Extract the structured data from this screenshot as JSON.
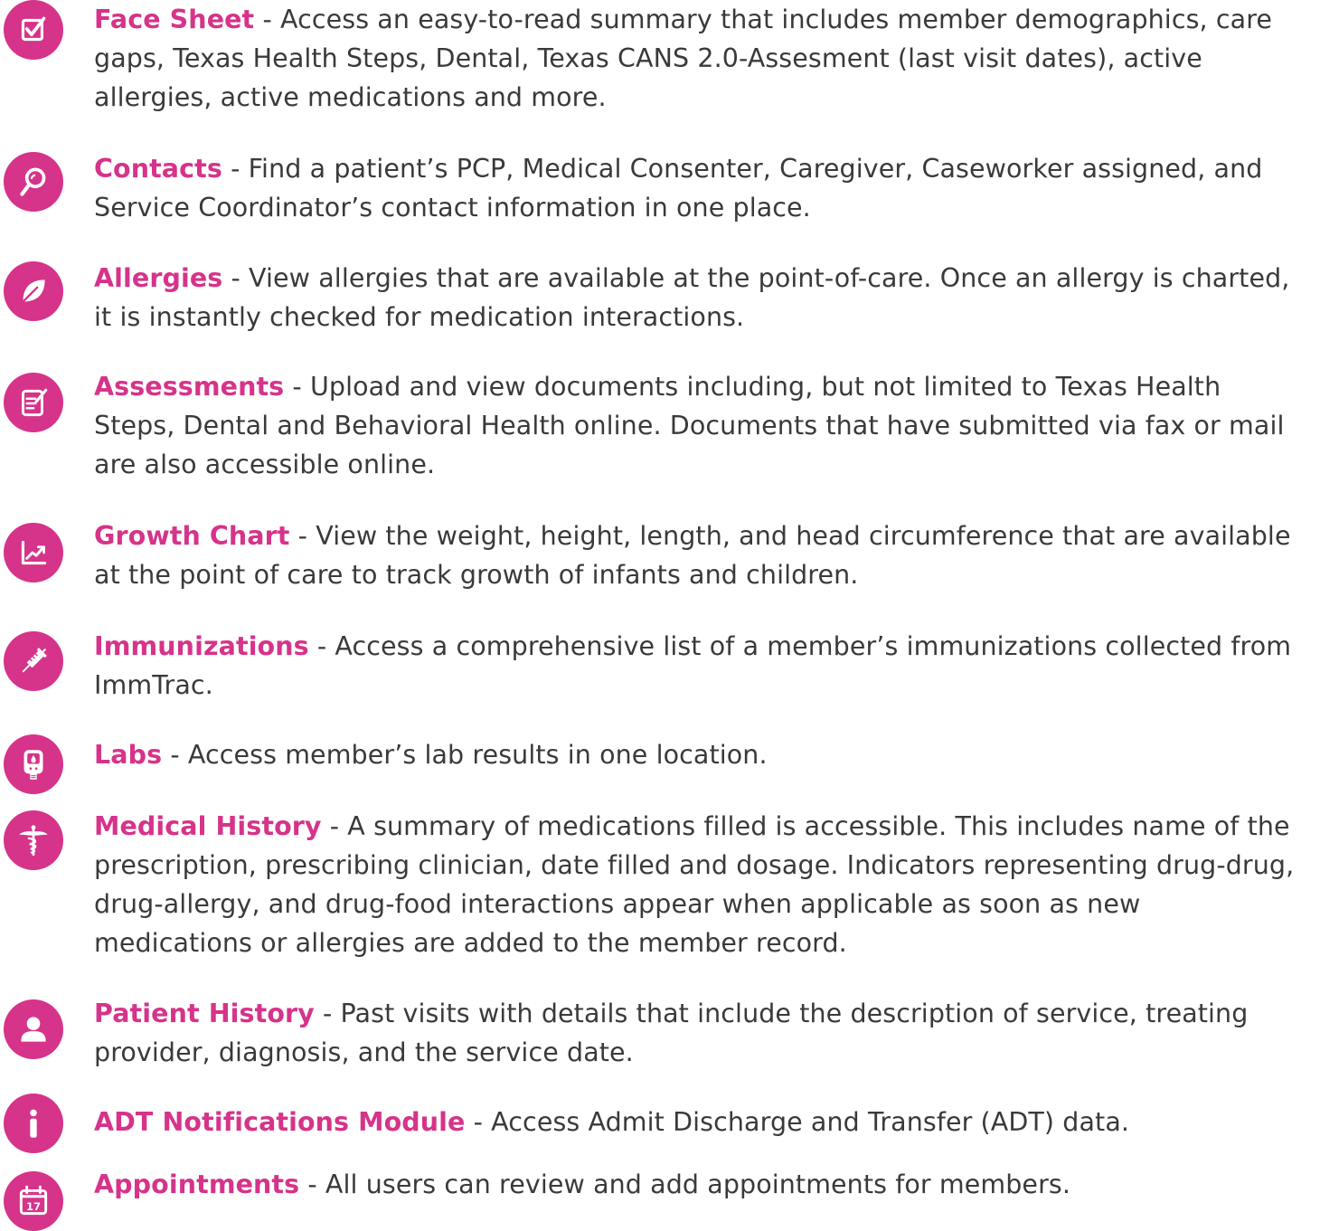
{
  "features": [
    {
      "icon": "checkbox-icon",
      "title": "Face Sheet",
      "description": " - Access an easy-to-read summary that includes member demographics, care gaps, Texas Health Steps, Dental, Texas CANS 2.0-Assesment (last visit dates), active allergies, active medications and more."
    },
    {
      "icon": "magnifier-icon",
      "title": "Contacts",
      "description": " - Find a patient’s PCP, Medical Consenter, Caregiver, Caseworker assigned, and Service Coordinator’s contact information in one place."
    },
    {
      "icon": "leaf-icon",
      "title": "Allergies",
      "description": " - View allergies that are available at the point-of-care. Once an allergy is charted, it is instantly checked for medication interactions."
    },
    {
      "icon": "document-edit-icon",
      "title": "Assessments",
      "description": " - Upload and view documents including, but not limited to Texas Health Steps, Dental and Behavioral Health online. Documents that have submitted via fax or mail are also accessible online."
    },
    {
      "icon": "growth-chart-icon",
      "title": "Growth Chart",
      "description": " - View the weight, height, length, and head circumference that are available at the point of care to track growth of infants and children."
    },
    {
      "icon": "syringe-icon",
      "title": "Immunizations",
      "description": " - Access a comprehensive list of a member’s immunizations collected from ImmTrac."
    },
    {
      "icon": "lab-meter-icon",
      "title": "Labs",
      "description": " - Access member’s lab results in one location."
    },
    {
      "icon": "caduceus-icon",
      "title": "Medical History",
      "description": " - A summary of medications filled is accessible. This includes name of the prescription, prescribing clinician, date filled and dosage. Indicators representing drug-drug, drug-allergy, and drug-food interactions appear when applicable as soon as new medications or allergies are added to the member record."
    },
    {
      "icon": "person-icon",
      "title": "Patient History",
      "description": " - Past visits with details that include the description of service, treating provider, diagnosis, and the service date."
    },
    {
      "icon": "info-icon",
      "title": "ADT Notifications Module",
      "description": "  - Access Admit Discharge and Transfer (ADT) data."
    },
    {
      "icon": "calendar-icon",
      "title": "Appointments",
      "description": " - All users can review and add appointments for members.",
      "calendar_day": "17"
    }
  ]
}
